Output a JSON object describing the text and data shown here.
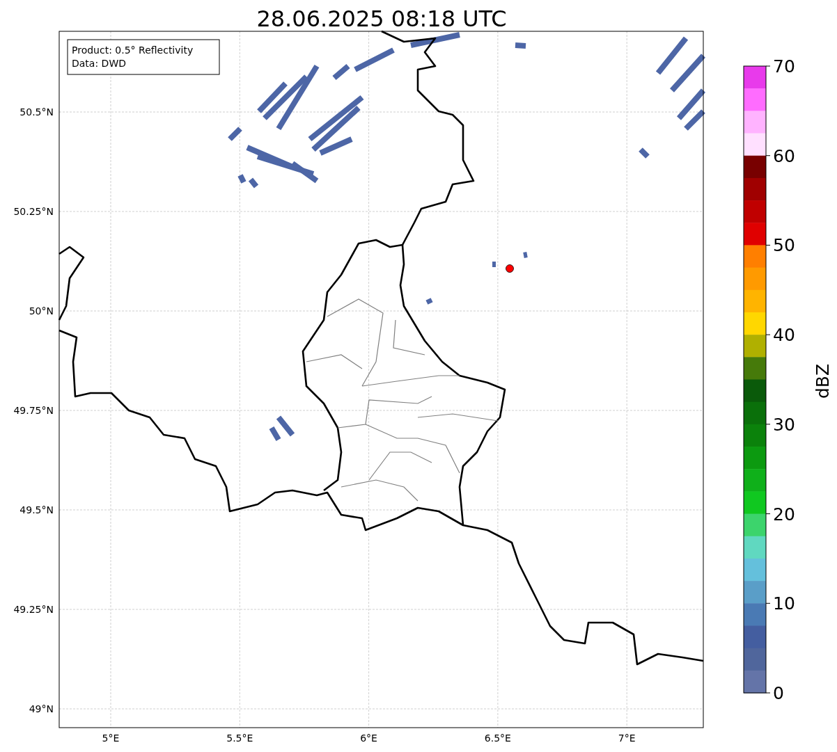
{
  "title": "28.06.2025 08:18 UTC",
  "info_box": [
    "Product: 0.5° Reflectivity",
    "Data: DWD"
  ],
  "lat_ticks": [
    "50.5°N",
    "50.25°N",
    "50°N",
    "49.75°N",
    "49.5°N",
    "49.25°N",
    "49°N"
  ],
  "lon_ticks": [
    "5°E",
    "5.5°E",
    "6°E",
    "6.5°E",
    "7°E"
  ],
  "colorbar": {
    "label": "dBZ",
    "ticks": [
      "70",
      "60",
      "50",
      "40",
      "30",
      "20",
      "10",
      "0"
    ],
    "bins": [
      {
        "color": "#e83aeb"
      },
      {
        "color": "#ff6cff"
      },
      {
        "color": "#ffb3ff"
      },
      {
        "color": "#ffe0ff"
      },
      {
        "color": "#780000"
      },
      {
        "color": "#a00000"
      },
      {
        "color": "#c00000"
      },
      {
        "color": "#e00000"
      },
      {
        "color": "#ff7f00"
      },
      {
        "color": "#ff9a00"
      },
      {
        "color": "#ffb400"
      },
      {
        "color": "#ffd700"
      },
      {
        "color": "#b0b000"
      },
      {
        "color": "#467a0a"
      },
      {
        "color": "#0a5a0a"
      },
      {
        "color": "#0a700a"
      },
      {
        "color": "#0b820b"
      },
      {
        "color": "#0c9a10"
      },
      {
        "color": "#0fb01a"
      },
      {
        "color": "#10c820"
      },
      {
        "color": "#3cd46c"
      },
      {
        "color": "#60d8c0"
      },
      {
        "color": "#64c0dc"
      },
      {
        "color": "#5a9ec8"
      },
      {
        "color": "#4a7ab4"
      },
      {
        "color": "#445ea0"
      },
      {
        "color": "#50669c"
      },
      {
        "color": "#6474a8"
      }
    ]
  }
}
